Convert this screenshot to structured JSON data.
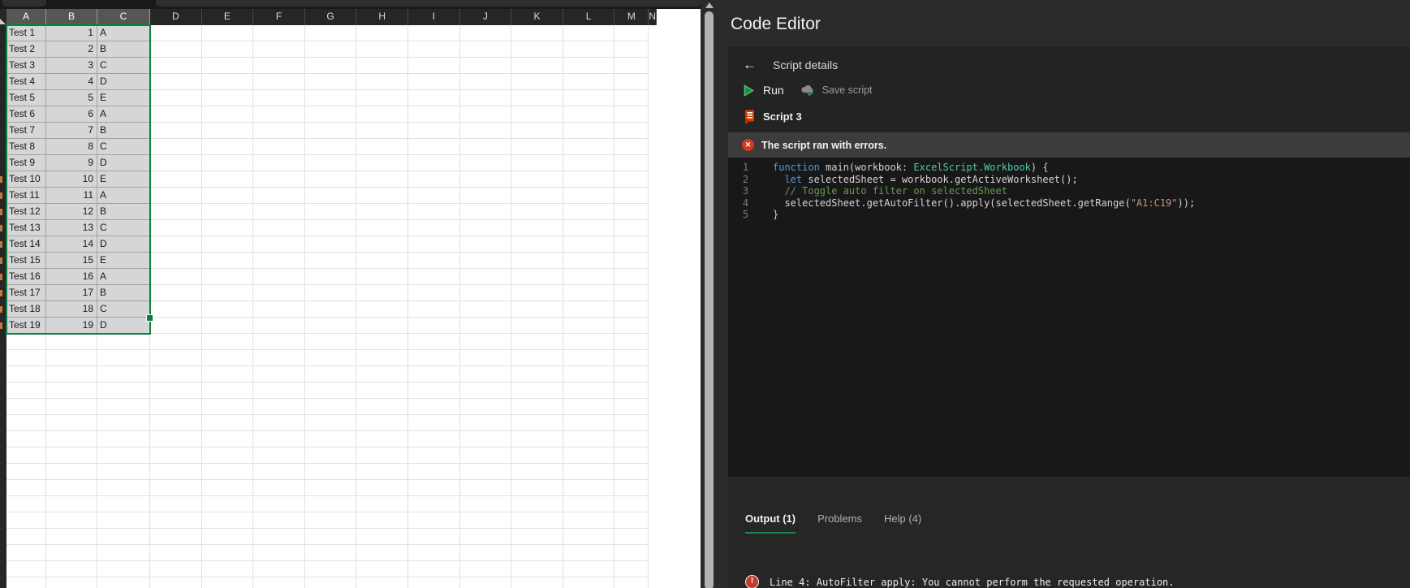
{
  "colors": {
    "accent_green": "#107c41",
    "tab_underline_green": "#1a8a4c",
    "run_green": "#1f8b3d",
    "script_icon_orange": "#d83b01",
    "error_red": "#d13a22",
    "selection_fill": "#d6d6d6",
    "syntax": {
      "kw": "#569cd6",
      "ty": "#4ec9b0",
      "cm": "#6a9955",
      "st": "#ce9178",
      "df": "#d4d4d4"
    }
  },
  "spreadsheet": {
    "columns": [
      "A",
      "B",
      "C",
      "D",
      "E",
      "F",
      "G",
      "H",
      "I",
      "J",
      "K",
      "L",
      "M",
      "N"
    ],
    "selected_columns": [
      "A",
      "B",
      "C"
    ],
    "selected_range": "A1:C19",
    "rows": [
      {
        "name": "Test 1",
        "value": "1",
        "letter": "A"
      },
      {
        "name": "Test 2",
        "value": "2",
        "letter": "B"
      },
      {
        "name": "Test 3",
        "value": "3",
        "letter": "C"
      },
      {
        "name": "Test 4",
        "value": "4",
        "letter": "D"
      },
      {
        "name": "Test 5",
        "value": "5",
        "letter": "E"
      },
      {
        "name": "Test 6",
        "value": "6",
        "letter": "A"
      },
      {
        "name": "Test 7",
        "value": "7",
        "letter": "B"
      },
      {
        "name": "Test 8",
        "value": "8",
        "letter": "C"
      },
      {
        "name": "Test 9",
        "value": "9",
        "letter": "D"
      },
      {
        "name": "Test 10",
        "value": "10",
        "letter": "E"
      },
      {
        "name": "Test 11",
        "value": "11",
        "letter": "A"
      },
      {
        "name": "Test 12",
        "value": "12",
        "letter": "B"
      },
      {
        "name": "Test 13",
        "value": "13",
        "letter": "C"
      },
      {
        "name": "Test 14",
        "value": "14",
        "letter": "D"
      },
      {
        "name": "Test 15",
        "value": "15",
        "letter": "E"
      },
      {
        "name": "Test 16",
        "value": "16",
        "letter": "A"
      },
      {
        "name": "Test 17",
        "value": "17",
        "letter": "B"
      },
      {
        "name": "Test 18",
        "value": "18",
        "letter": "C"
      },
      {
        "name": "Test 19",
        "value": "19",
        "letter": "D"
      }
    ]
  },
  "code_editor": {
    "title": "Code Editor",
    "header": {
      "back_label": "Script details"
    },
    "toolbar": {
      "run_label": "Run",
      "save_label": "Save script"
    },
    "script_name": "Script 3",
    "status_banner": "The script ran with errors.",
    "code": {
      "lines": [
        {
          "n": "1",
          "tokens": [
            {
              "t": "function",
              "c": "kw"
            },
            {
              "t": " main(workbook: ",
              "c": "df"
            },
            {
              "t": "ExcelScript.Workbook",
              "c": "ty"
            },
            {
              "t": ") {",
              "c": "df"
            }
          ]
        },
        {
          "n": "2",
          "tokens": [
            {
              "t": "  ",
              "c": "df"
            },
            {
              "t": "let",
              "c": "kw"
            },
            {
              "t": " selectedSheet = workbook.getActiveWorksheet();",
              "c": "df"
            }
          ]
        },
        {
          "n": "3",
          "tokens": [
            {
              "t": "  // Toggle auto filter on selectedSheet",
              "c": "cm"
            }
          ]
        },
        {
          "n": "4",
          "tokens": [
            {
              "t": "  selectedSheet.getAutoFilter().apply(selectedSheet.getRange(",
              "c": "df"
            },
            {
              "t": "\"A1:C19\"",
              "c": "st"
            },
            {
              "t": "));",
              "c": "df"
            }
          ]
        },
        {
          "n": "5",
          "tokens": [
            {
              "t": "}",
              "c": "df"
            }
          ]
        }
      ]
    },
    "tabs": [
      {
        "label": "Output (1)",
        "active": true
      },
      {
        "label": "Problems",
        "active": false
      },
      {
        "label": "Help (4)",
        "active": false
      }
    ],
    "output": {
      "message": "Line 4: AutoFilter apply: You cannot perform the requested operation."
    }
  }
}
